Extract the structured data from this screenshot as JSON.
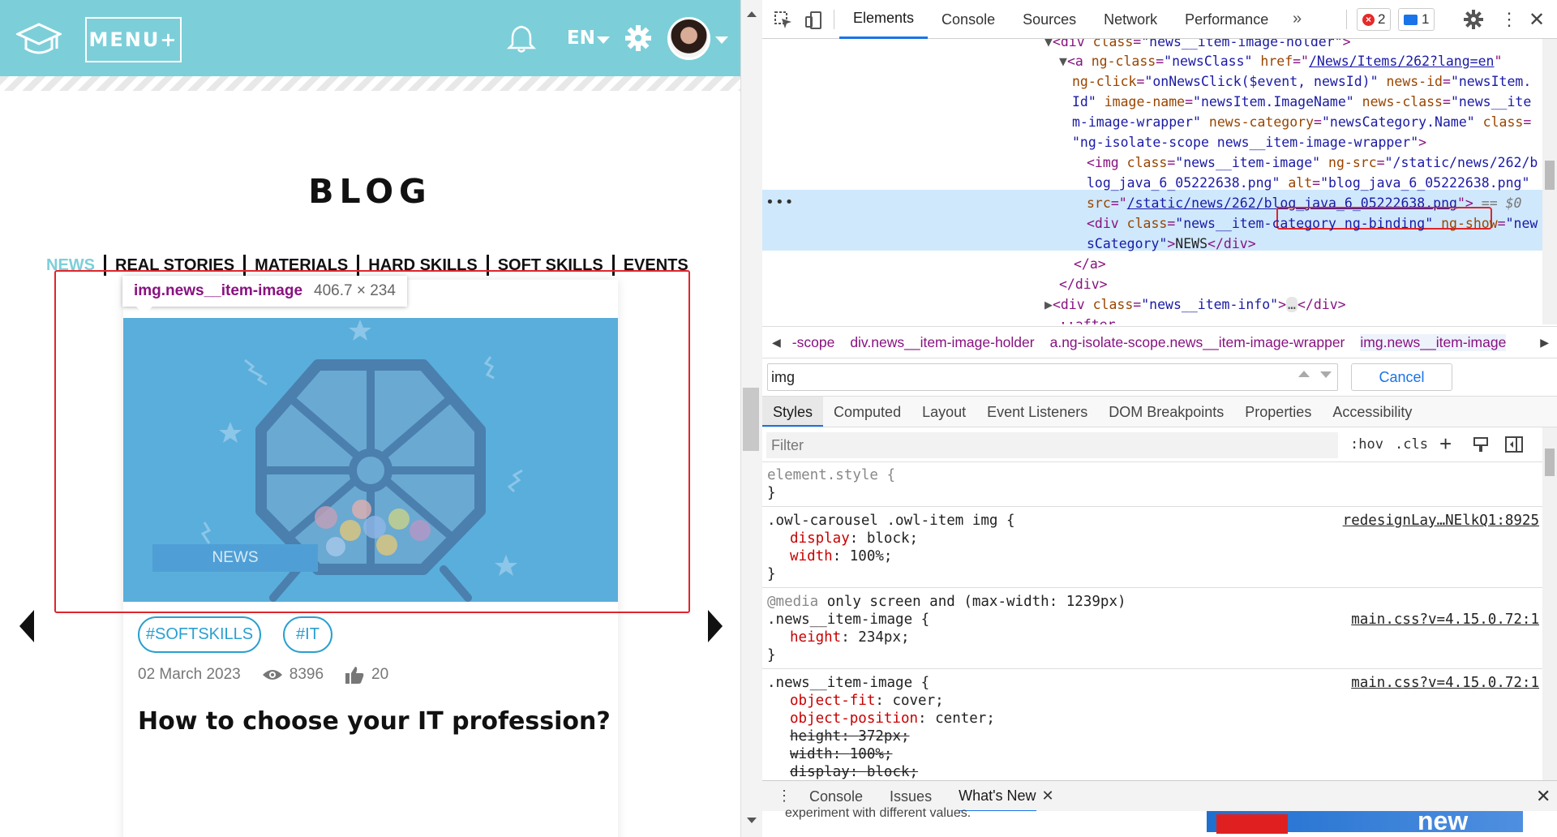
{
  "site": {
    "menu_label": "MENU",
    "lang": "EN",
    "blog_title": "BLOG",
    "categories": [
      "NEWS",
      "REAL STORIES",
      "MATERIALS",
      "HARD SKILLS",
      "SOFT SKILLS",
      "EVENTS"
    ],
    "tooltip": {
      "selector": "img.news__item-image",
      "size": "406.7 × 234"
    },
    "card": {
      "image_tag": "NEWS",
      "hashtags": [
        "#SOFTSKILLS",
        "#IT"
      ],
      "date": "02 March 2023",
      "views": "8396",
      "likes": "20",
      "title": "How to choose your IT profession?"
    },
    "colors": {
      "header": "#7ccfd9",
      "accent": "#2a9fd0",
      "highlight": "#e0252b"
    }
  },
  "devtools": {
    "tabs": [
      "Elements",
      "Console",
      "Sources",
      "Network",
      "Performance"
    ],
    "more_tabs": "»",
    "error_count": "2",
    "message_count": "1",
    "dom": {
      "l1_tag": "<div ",
      "l1_attr": "class",
      "l1_val": "\"news__item-image-holder\"",
      "l1_end": ">",
      "l2_tag": "<a ",
      "l2_a1": "ng-class",
      "l2_v1": "\"newsClass\"",
      "l2_a2": " href",
      "l2_v2": "/News/Items/262?lang=en",
      "l3_a1": "ng-click",
      "l3_v1": "\"onNewsClick($event, newsId)\"",
      "l3_a2": " news-id",
      "l3_v2": "\"newsItem.",
      "l4_v1": "Id\"",
      "l4_a1": " image-name",
      "l4_v2": "\"newsItem.ImageName\"",
      "l4_a2": " news-class",
      "l4_v3": "\"news__ite",
      "l5_v1": "m-image-wrapper\"",
      "l5_a1": " news-category",
      "l5_v2": "\"newsCategory.Name\"",
      "l5_a2": " class",
      "l6_v1": "\"ng-isolate-scope news__item-image-wrapper\"",
      "l6_end": ">",
      "l7_tag": "<img ",
      "l7_a1": "class",
      "l7_v1": "\"news__item-image\"",
      "l7_a2": " ng-src",
      "l7_v2": "\"/static/news/262/b",
      "l8_v1": "log_java_6_05222638.png\"",
      "l8_a1": " alt",
      "l8_v2": "\"blog_java_6_05222638.png\"",
      "l9_a1": "src",
      "l9_v1": "/static/news/262/blog_java_6_05222638.png",
      "l9_end": "\">",
      "l9_eq": " == $0",
      "l10_tag": "<div ",
      "l10_a1": "class",
      "l10_v1": "\"news__item-category ng-binding\"",
      "l10_a2": " ng-show",
      "l10_v2": "\"new",
      "l11_v1": "sCategory\"",
      "l11_text": "NEWS",
      "l11_close": "</div>",
      "l12": "</a>",
      "l13": "</div>",
      "l14_tag": "<div ",
      "l14_a1": "class",
      "l14_v1": "\"news__item-info\"",
      "l14_ellipsis": "…",
      "l14_close": "</div>",
      "l15": "::after"
    },
    "breadcrumbs": [
      "-scope",
      "div.news__item-image-holder",
      "a.ng-isolate-scope.news__item-image-wrapper",
      "img.news__item-image"
    ],
    "search_value": "img",
    "cancel_label": "Cancel",
    "style_tabs": [
      "Styles",
      "Computed",
      "Layout",
      "Event Listeners",
      "DOM Breakpoints",
      "Properties",
      "Accessibility"
    ],
    "filter_placeholder": "Filter",
    "hov": ":hov",
    "cls": ".cls",
    "styles": {
      "r1_sel": "element.style {",
      "r1_end": "}",
      "r2_sel": ".owl-carousel .owl-item img {",
      "r2_src": "redesignLay…NElkQ1:8925",
      "r2_p1": "display",
      "r2_v1": "block;",
      "r2_p2": "width",
      "r2_v2": "100%;",
      "r2_end": "}",
      "r3_media_kw": "@media",
      "r3_media": " only screen and (max-width: 1239px)",
      "r3_sel": ".news__item-image {",
      "r3_src": "main.css?v=4.15.0.72:1",
      "r3_p1": "height",
      "r3_v1": "234px;",
      "r3_end": "}",
      "r4_sel": ".news__item-image {",
      "r4_src": "main.css?v=4.15.0.72:1",
      "r4_p1": "object-fit",
      "r4_v1": "cover;",
      "r4_p2": "object-position",
      "r4_v2": "center;",
      "r4_p3": "height",
      "r4_v3": "372px;",
      "r4_p4": "width",
      "r4_v4": "100%;",
      "r4_p5": "display",
      "r4_v5": "block;"
    },
    "drawer": {
      "tabs": [
        "Console",
        "Issues",
        "What's New"
      ],
      "peek": "experiment with different values.",
      "video_text": "new"
    }
  }
}
